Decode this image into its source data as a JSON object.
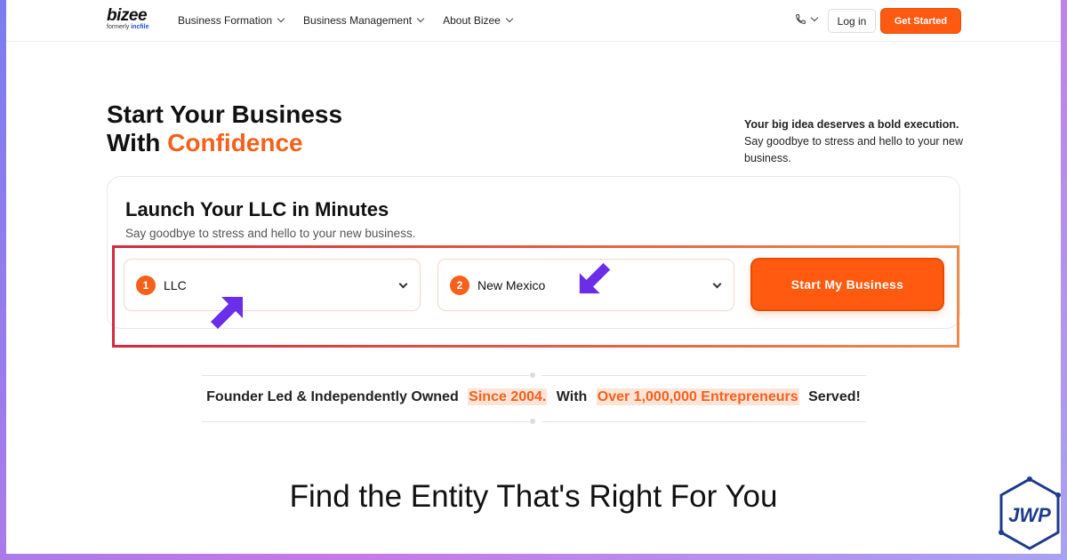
{
  "header": {
    "logo": "bizee",
    "logo_sub_prefix": "formerly",
    "logo_sub_brand": "incfile",
    "nav": [
      "Business Formation",
      "Business Management",
      "About Bizee"
    ],
    "login": "Log in",
    "get_started": "Get Started"
  },
  "hero": {
    "title_line1": "Start Your Business",
    "title_line2_prefix": "With",
    "title_line2_accent": "Confidence",
    "side_bold": "Your big idea deserves a bold execution.",
    "side_text": "Say goodbye to stress and hello to your new business."
  },
  "launch": {
    "title": "Launch Your LLC in Minutes",
    "subtitle": "Say goodbye to stress and hello to your new business.",
    "step1_num": "1",
    "step1_value": "LLC",
    "step2_num": "2",
    "step2_value": "New Mexico",
    "cta": "Start My Business"
  },
  "trust": {
    "part1": "Founder Led & Independently Owned",
    "hl1": "Since 2004.",
    "part2": "With",
    "hl2": "Over 1,000,000 Entrepreneurs",
    "part3": "Served!"
  },
  "entity_heading": "Find the Entity That's Right For You",
  "watermark": "JWP",
  "colors": {
    "accent": "#f5601b",
    "cta": "#ff5a0f",
    "highlight_border": "#d6293f",
    "arrow": "#6a2ee8"
  }
}
